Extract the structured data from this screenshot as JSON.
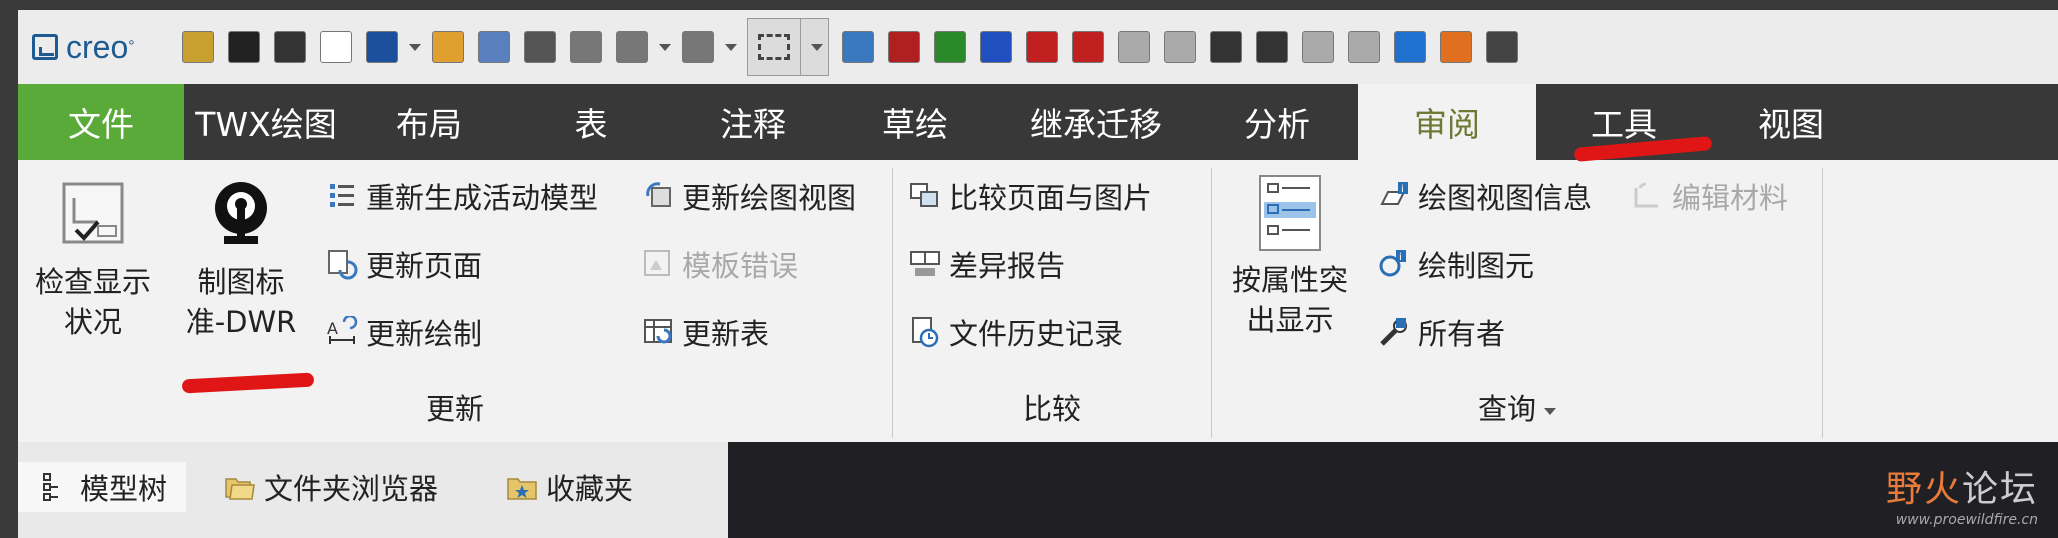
{
  "app": {
    "logo_text": "creo"
  },
  "quick_access": {
    "icons": [
      {
        "name": "check-model-icon",
        "color": "#c8a030"
      },
      {
        "name": "ruler-icon",
        "color": "#222222"
      },
      {
        "name": "broom-icon",
        "color": "#333333"
      },
      {
        "name": "new-file-icon",
        "color": "#ffffff"
      },
      {
        "name": "drawing-window-icon",
        "color": "#1c4f9c"
      },
      {
        "name": "open-folder-icon",
        "color": "#e0a030"
      },
      {
        "name": "edit-notes-icon",
        "color": "#5a7fbf"
      },
      {
        "name": "save-icon",
        "color": "#555555"
      },
      {
        "name": "save-as-icon",
        "color": "#777777"
      },
      {
        "name": "undo-icon",
        "color": "#777777"
      },
      {
        "name": "redo-icon",
        "color": "#777777"
      }
    ],
    "icons_right": [
      {
        "name": "regenerate-list-icon",
        "color": "#3a78c0"
      },
      {
        "name": "pencil-icon",
        "color": "#b02020"
      },
      {
        "name": "compare-screen-icon",
        "color": "#2a8a2a"
      },
      {
        "name": "paint-bucket-icon",
        "color": "#2050c0"
      },
      {
        "name": "text-style-icon",
        "color": "#c02020"
      },
      {
        "name": "v2-icon",
        "color": "#c02020"
      },
      {
        "name": "copy-icon",
        "color": "#aaaaaa"
      },
      {
        "name": "paste-icon",
        "color": "#aaaaaa"
      },
      {
        "name": "refresh-icon",
        "color": "#333333"
      },
      {
        "name": "close-windows-icon",
        "color": "#333333"
      },
      {
        "name": "edit-grey-icon",
        "color": "#aaaaaa"
      },
      {
        "name": "table-grey-icon",
        "color": "#aaaaaa"
      },
      {
        "name": "blue-cube-icon",
        "color": "#2070d0"
      },
      {
        "name": "drw-icon",
        "color": "#e07020"
      },
      {
        "name": "window-switch-icon",
        "color": "#444444"
      }
    ]
  },
  "tabs": [
    {
      "name": "tab-file",
      "label": "文件",
      "width": 166
    },
    {
      "name": "tab-twx-drawing",
      "label": "TWX绘图",
      "width": 164
    },
    {
      "name": "tab-layout",
      "label": "布局",
      "width": 162
    },
    {
      "name": "tab-table",
      "label": "表",
      "width": 162
    },
    {
      "name": "tab-annotate",
      "label": "注释",
      "width": 162
    },
    {
      "name": "tab-sketch",
      "label": "草绘",
      "width": 162
    },
    {
      "name": "tab-inheritance",
      "label": "继承迁移",
      "width": 200
    },
    {
      "name": "tab-analysis",
      "label": "分析",
      "width": 162
    },
    {
      "name": "tab-review",
      "label": "审阅",
      "width": 178
    },
    {
      "name": "tab-tools",
      "label": "工具",
      "width": 176
    },
    {
      "name": "tab-view",
      "label": "视图",
      "width": 158
    }
  ],
  "ribbon": {
    "update_group": {
      "label": "更新",
      "check_display": {
        "line1": "检查显示",
        "line2": "状况"
      },
      "drawing_standard": {
        "line1": "制图标",
        "line2": "准-DWR"
      },
      "regen_active_model": "重新生成活动模型",
      "update_pages": "更新页面",
      "update_draw": "更新绘制",
      "update_drawing_views": "更新绘图视图",
      "template_errors": "模板错误",
      "update_tables": "更新表"
    },
    "compare_group": {
      "label": "比较",
      "compare_page_image": "比较页面与图片",
      "diff_report": "差异报告",
      "file_history": "文件历史记录"
    },
    "query_group": {
      "label": "查询",
      "highlight_by_attr": {
        "line1": "按属性突",
        "line2": "出显示"
      },
      "view_info": "绘图视图信息",
      "draw_entity": "绘制图元",
      "owner": "所有者",
      "edit_material": "编辑材料"
    }
  },
  "nav_panel": {
    "model_tree": "模型树",
    "folder_browser": "文件夹浏览器",
    "favorites": "收藏夹"
  },
  "watermark": {
    "main_a": "野火",
    "main_b": "论坛",
    "url": "www.proewildfire.cn"
  }
}
